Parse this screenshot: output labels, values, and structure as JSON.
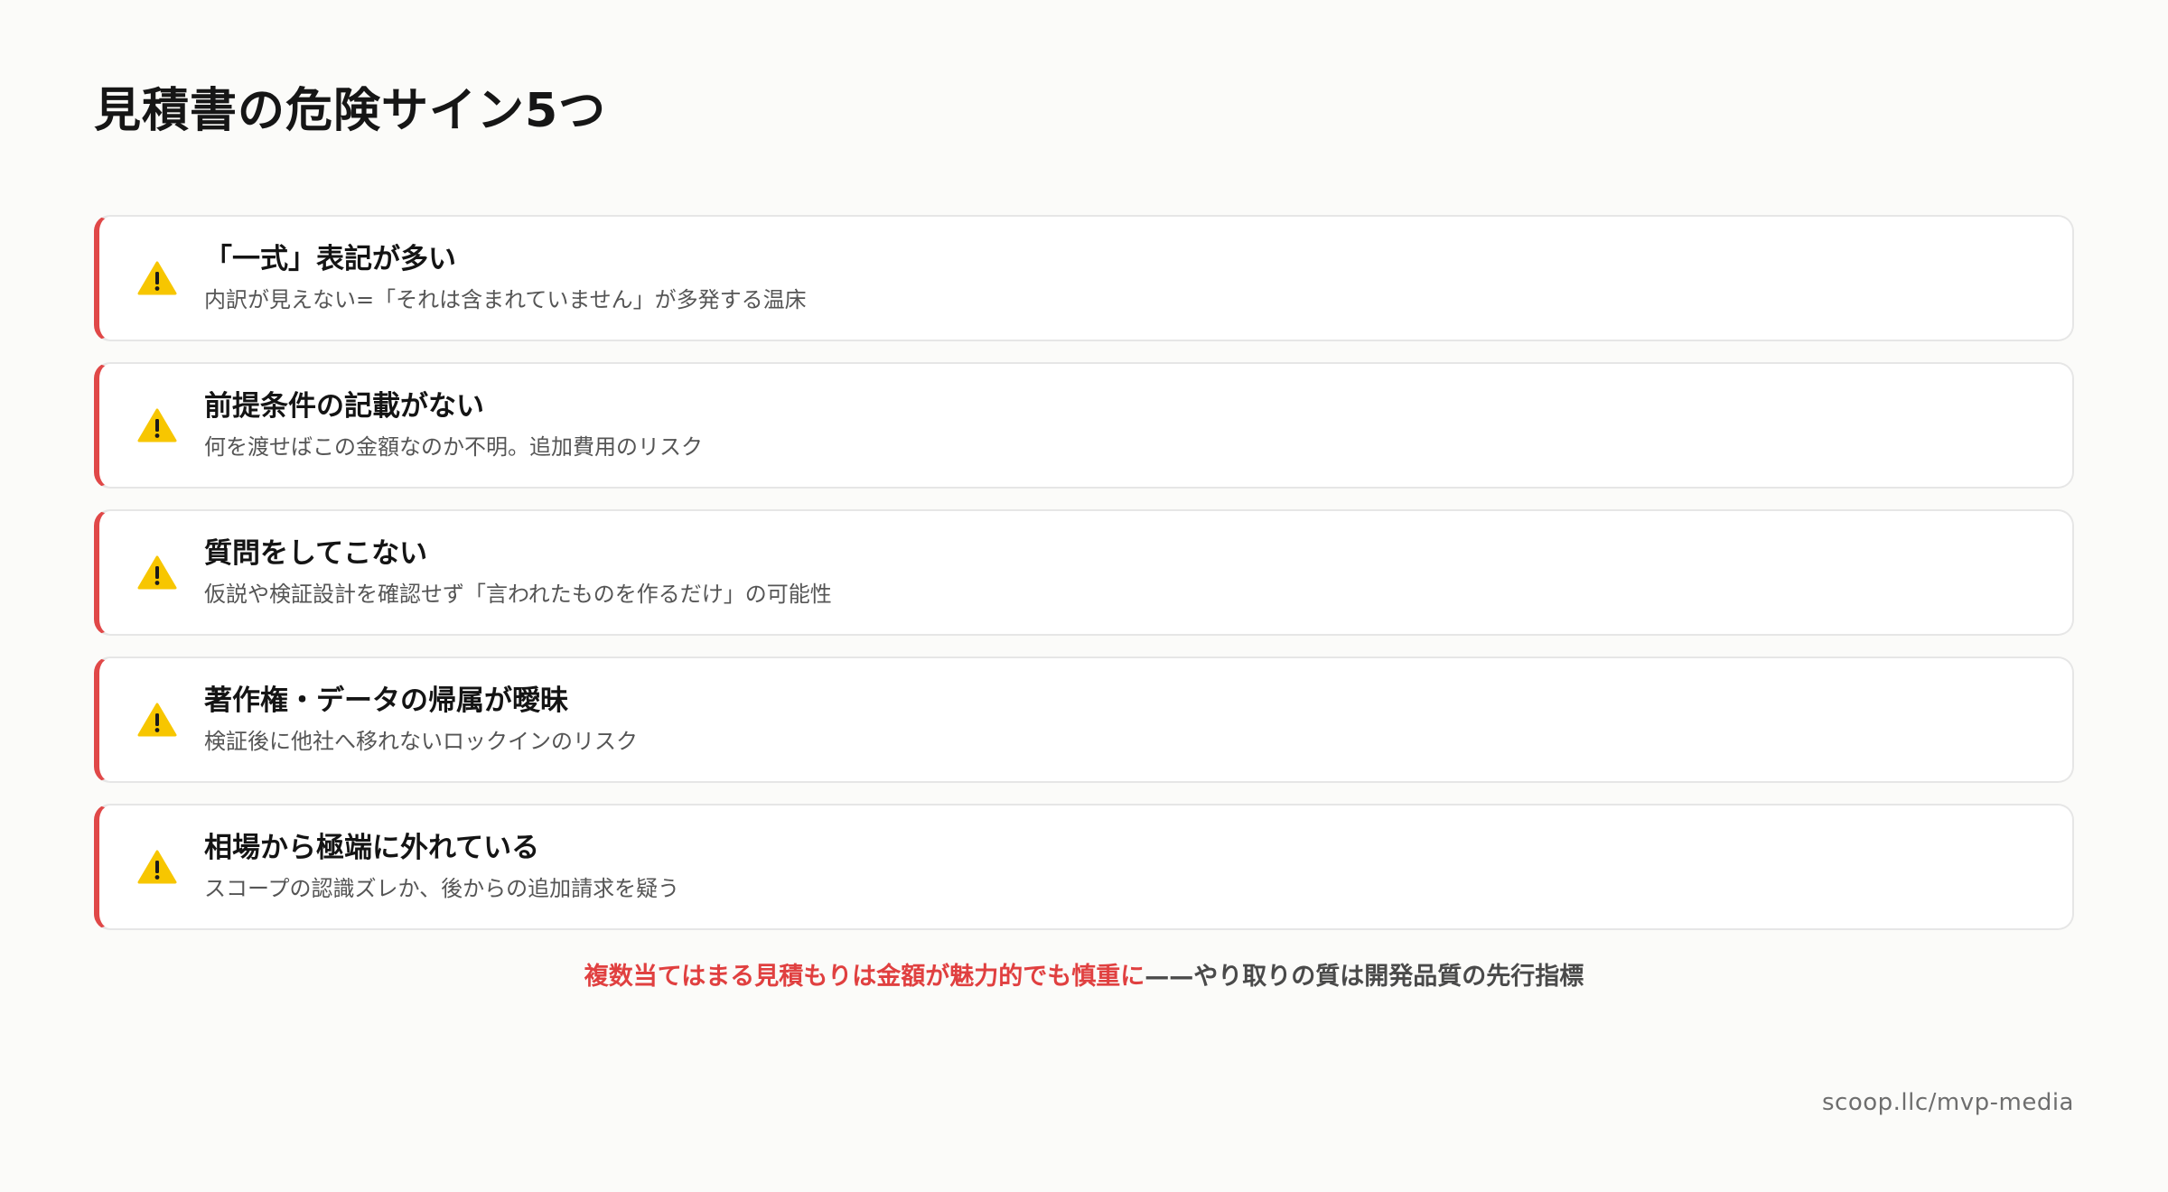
{
  "page": {
    "title": "見積書の危険サイン5つ"
  },
  "accent_color": "#e04848",
  "icon": "warning-icon",
  "cards": [
    {
      "heading": "「一式」表記が多い",
      "description": "内訳が見えない=「それは含まれていません」が多発する温床"
    },
    {
      "heading": "前提条件の記載がない",
      "description": "何を渡せばこの金額なのか不明。追加費用のリスク"
    },
    {
      "heading": "質問をしてこない",
      "description": "仮説や検証設計を確認せず「言われたものを作るだけ」の可能性"
    },
    {
      "heading": "著作権・データの帰属が曖昧",
      "description": "検証後に他社へ移れないロックインのリスク"
    },
    {
      "heading": "相場から極端に外れている",
      "description": "スコープの認識ズレか、後からの追加請求を疑う"
    }
  ],
  "summary": {
    "highlight": "複数当てはまる見積もりは金額が魅力的でも慎重に",
    "rest": "——やり取りの質は開発品質の先行指標",
    "highlight_color": "#e04040"
  },
  "footer": {
    "url": "scoop.llc/mvp-media"
  }
}
